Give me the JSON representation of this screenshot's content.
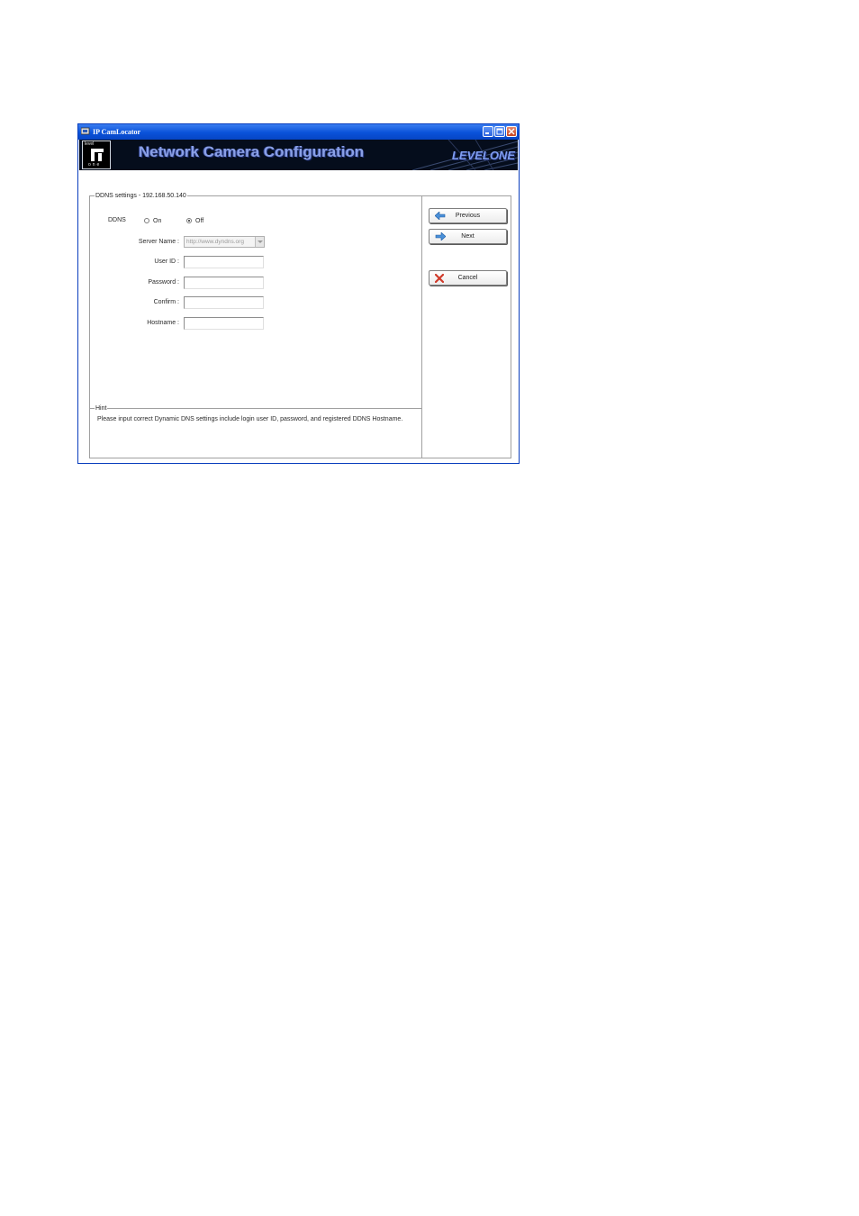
{
  "window": {
    "title": "IP CamLocator"
  },
  "banner": {
    "logo_top": "level",
    "logo_bottom": "one",
    "title": "Network Camera Configuration",
    "brand": "LEVELONE"
  },
  "ddns_group": {
    "legend": "DDNS settings - 192.168.50.140",
    "ddns_label": "DDNS",
    "radio_on_label": "On",
    "radio_off_label": "Off",
    "selected": "Off",
    "server_name_label": "Server Name :",
    "server_name_value": "http://www.dyndns.org",
    "user_id_label": "User ID :",
    "user_id_value": "",
    "password_label": "Password :",
    "password_value": "",
    "confirm_label": "Confirm :",
    "confirm_value": "",
    "hostname_label": "Hostname :",
    "hostname_value": ""
  },
  "hint": {
    "legend": "Hint",
    "text": "Please input correct Dynamic DNS settings include login user ID, password, and registered DDNS Hostname."
  },
  "buttons": {
    "previous": "Previous",
    "next": "Next",
    "cancel": "Cancel"
  },
  "colors": {
    "titlebar": "#0a52d9",
    "banner_bg": "#050d1c",
    "banner_text": "#8aa0e6",
    "previous_icon": "#4a90d9",
    "cancel_icon": "#d03a2a"
  }
}
